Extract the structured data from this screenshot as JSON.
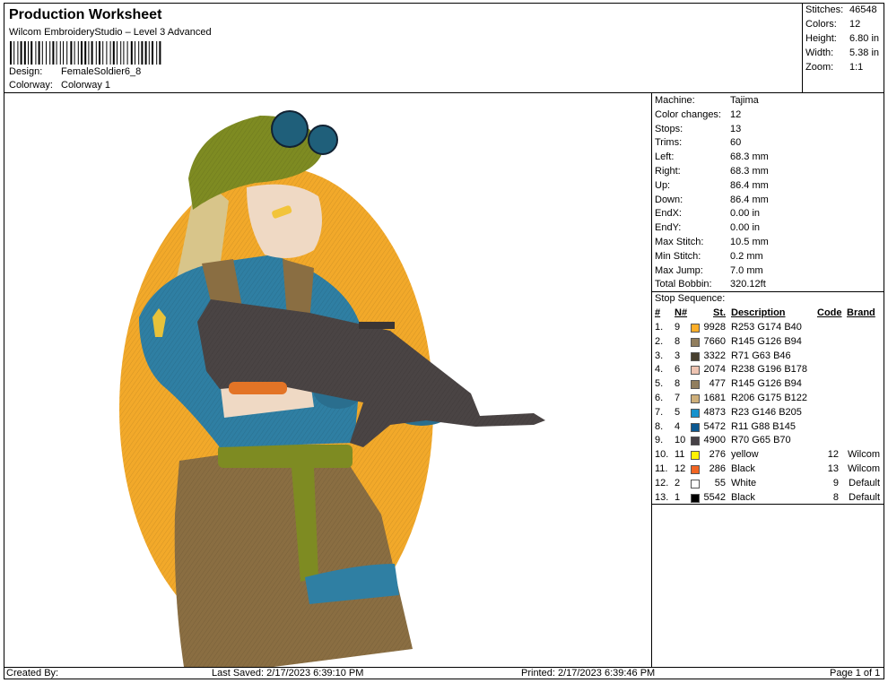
{
  "header": {
    "title": "Production Worksheet",
    "subtitle": "Wilcom EmbroideryStudio – Level 3 Advanced",
    "design_label": "Design:",
    "design_value": "FemaleSoldier6_8",
    "colorway_label": "Colorway:",
    "colorway_value": "Colorway 1"
  },
  "stats": [
    {
      "label": "Stitches:",
      "value": "46548"
    },
    {
      "label": "Colors:",
      "value": "12"
    },
    {
      "label": "Height:",
      "value": "6.80 in"
    },
    {
      "label": "Width:",
      "value": "5.38 in"
    },
    {
      "label": "Zoom:",
      "value": "1:1"
    }
  ],
  "machine": [
    {
      "label": "Machine:",
      "value": "Tajima"
    },
    {
      "label": "Color changes:",
      "value": "12"
    },
    {
      "label": "Stops:",
      "value": "13"
    },
    {
      "label": "Trims:",
      "value": "60"
    },
    {
      "label": "Left:",
      "value": "68.3 mm"
    },
    {
      "label": "Right:",
      "value": "68.3 mm"
    },
    {
      "label": "Up:",
      "value": "86.4 mm"
    },
    {
      "label": "Down:",
      "value": "86.4 mm"
    },
    {
      "label": "EndX:",
      "value": "0.00 in"
    },
    {
      "label": "EndY:",
      "value": "0.00 in"
    },
    {
      "label": "Max Stitch:",
      "value": "10.5 mm"
    },
    {
      "label": "Min Stitch:",
      "value": "0.2 mm"
    },
    {
      "label": "Max Jump:",
      "value": "7.0 mm"
    },
    {
      "label": "Total Bobbin:",
      "value": "320.12ft"
    }
  ],
  "sequence": {
    "title": "Stop Sequence:",
    "headers": {
      "num": "#",
      "n": "N#",
      "st": "St.",
      "desc": "Description",
      "code": "Code",
      "brand": "Brand"
    },
    "rows": [
      {
        "num": "1.",
        "n": "9",
        "color": "#FDAE28",
        "st": "9928",
        "desc": "R253 G174 B40",
        "code": "",
        "brand": ""
      },
      {
        "num": "2.",
        "n": "8",
        "color": "#917E5E",
        "st": "7660",
        "desc": "R145 G126 B94",
        "code": "",
        "brand": ""
      },
      {
        "num": "3.",
        "n": "3",
        "color": "#473F2E",
        "st": "3322",
        "desc": "R71 G63 B46",
        "code": "",
        "brand": ""
      },
      {
        "num": "4.",
        "n": "6",
        "color": "#EEC4B2",
        "st": "2074",
        "desc": "R238 G196 B178",
        "code": "",
        "brand": ""
      },
      {
        "num": "5.",
        "n": "8",
        "color": "#917E5E",
        "st": "477",
        "desc": "R145 G126 B94",
        "code": "",
        "brand": ""
      },
      {
        "num": "6.",
        "n": "7",
        "color": "#CEAF7A",
        "st": "1681",
        "desc": "R206 G175 B122",
        "code": "",
        "brand": ""
      },
      {
        "num": "7.",
        "n": "5",
        "color": "#1792CD",
        "st": "4873",
        "desc": "R23 G146 B205",
        "code": "",
        "brand": ""
      },
      {
        "num": "8.",
        "n": "4",
        "color": "#0B5891",
        "st": "5472",
        "desc": "R11 G88 B145",
        "code": "",
        "brand": ""
      },
      {
        "num": "9.",
        "n": "10",
        "color": "#464146",
        "st": "4900",
        "desc": "R70 G65 B70",
        "code": "",
        "brand": ""
      },
      {
        "num": "10.",
        "n": "11",
        "color": "#FFF200",
        "st": "276",
        "desc": "yellow",
        "code": "12",
        "brand": "Wilcom"
      },
      {
        "num": "11.",
        "n": "12",
        "color": "#F26522",
        "st": "286",
        "desc": "Black",
        "code": "13",
        "brand": "Wilcom"
      },
      {
        "num": "12.",
        "n": "2",
        "color": "#FFFFFF",
        "st": "55",
        "desc": "White",
        "code": "9",
        "brand": "Default"
      },
      {
        "num": "13.",
        "n": "1",
        "color": "#000000",
        "st": "5542",
        "desc": "Black",
        "code": "8",
        "brand": "Default"
      }
    ]
  },
  "footer": {
    "created": "Created By:",
    "saved": "Last Saved: 2/17/2023 6:39:10 PM",
    "printed": "Printed: 2/17/2023 6:39:46 PM",
    "page": "Page 1 of 1"
  },
  "colors": {
    "oval": "#F2A92A",
    "helmet": "#7E8B22",
    "jacket": "#2F7FA3",
    "pants": "#8A6E42",
    "gun": "#4A4444",
    "hair": "#D8C58A",
    "skin": "#EFD9C4"
  },
  "icons": {
    "preview": "embroidery-design-preview"
  }
}
